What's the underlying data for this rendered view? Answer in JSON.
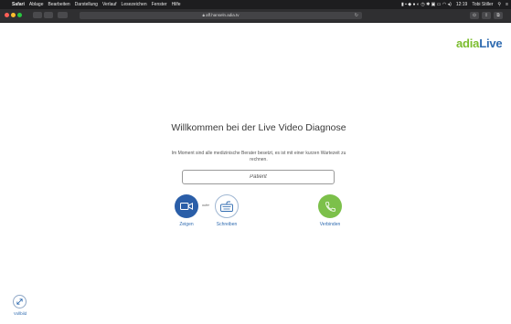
{
  "menubar": {
    "app": "Safari",
    "items": [
      "Ablage",
      "Bearbeiten",
      "Darstellung",
      "Verlauf",
      "Lesezeichen",
      "Fenster",
      "Hilfe"
    ],
    "time": "12:19",
    "user": "Tobi Stiller"
  },
  "toolbar": {
    "url": "aff.hanseln.adia.tv"
  },
  "logo": {
    "part1": "adia",
    "part2": "Live",
    "color1": "#7bbd2e",
    "color2": "#2f6bb0"
  },
  "main": {
    "title": "Willkommen bei der Live Video Diagnose",
    "subtitle": "Im Moment sind alle medizinische Berater besetzt, es ist mit einer kurzen Wartezeit zu rechnen.",
    "name_input_value": "Patient",
    "or_label": "oder",
    "buttons": {
      "zeigen": "Zeigen",
      "schreiben": "Schreiben",
      "verbinden": "Verbinden"
    }
  },
  "footer": {
    "fullscreen_label": "Vollbild"
  },
  "colors": {
    "blue": "#2a5ea8",
    "green": "#7cc04a"
  }
}
